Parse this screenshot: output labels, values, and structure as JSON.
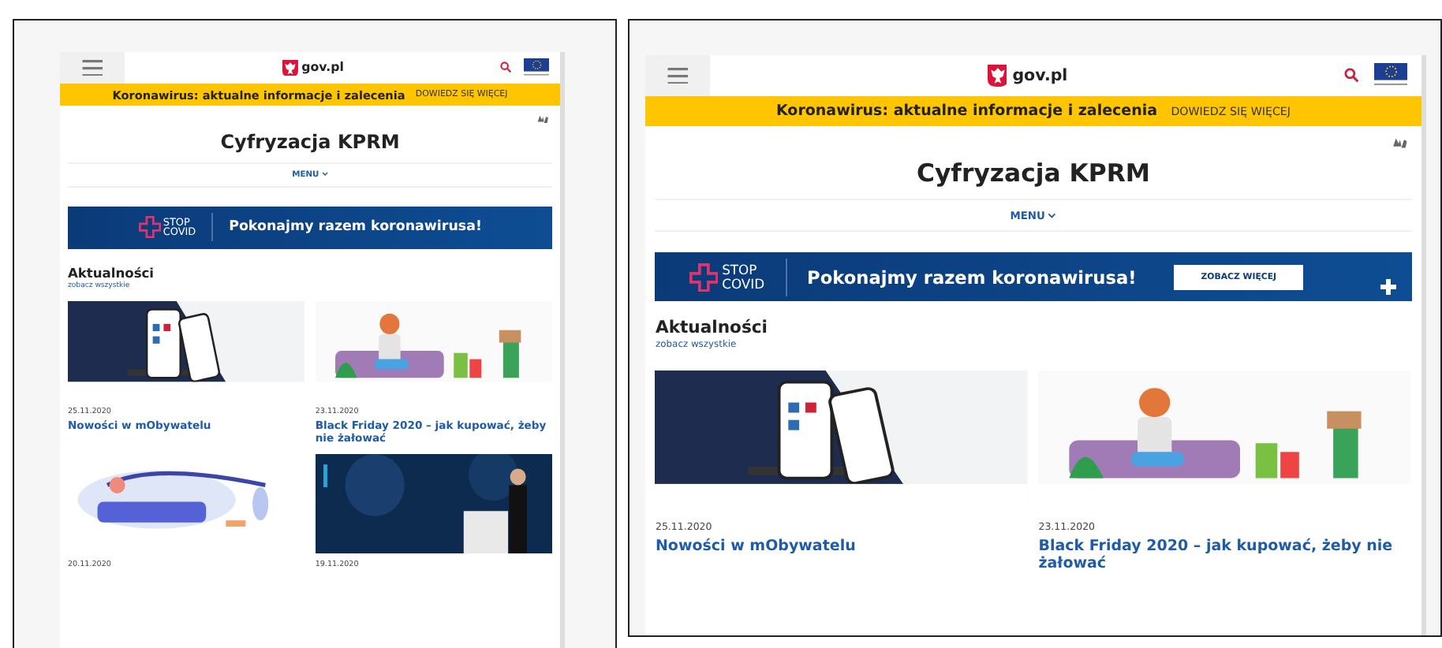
{
  "frames": [
    {
      "header": {
        "logo_text": "gov.pl"
      },
      "alert": {
        "text": "Koronawirus: aktualne informacje i zalecenia",
        "link": "DOWIEDZ SIĘ WIĘCEJ"
      },
      "site_title": "Cyfryzacja KPRM",
      "menu": "MENU",
      "banner": {
        "logo_top": "STOP",
        "logo_bottom": "COVID",
        "text": "Pokonajmy razem koronawirusa!"
      },
      "news": {
        "heading": "Aktualności",
        "see_all": "zobacz wszystkie",
        "articles": [
          {
            "date": "25.11.2020",
            "title": "Nowości w mObywatelu"
          },
          {
            "date": "23.11.2020",
            "title": "Black Friday 2020 – jak kupować, żeby nie żałować"
          },
          {
            "date": "20.11.2020"
          },
          {
            "date": "19.11.2020"
          }
        ]
      }
    },
    {
      "header": {
        "logo_text": "gov.pl"
      },
      "alert": {
        "text": "Koronawirus: aktualne informacje i zalecenia",
        "link": "DOWIEDZ SIĘ WIĘCEJ"
      },
      "site_title": "Cyfryzacja KPRM",
      "menu": "MENU",
      "banner": {
        "logo_top": "STOP",
        "logo_bottom": "COVID",
        "text": "Pokonajmy razem koronawirusa!",
        "button": "ZOBACZ WIĘCEJ"
      },
      "news": {
        "heading": "Aktualności",
        "see_all": "zobacz wszystkie",
        "articles": [
          {
            "date": "25.11.2020",
            "title": "Nowości w mObywatelu"
          },
          {
            "date": "23.11.2020",
            "title": "Black Friday 2020 – jak kupować, żeby nie żałować"
          }
        ]
      }
    }
  ]
}
